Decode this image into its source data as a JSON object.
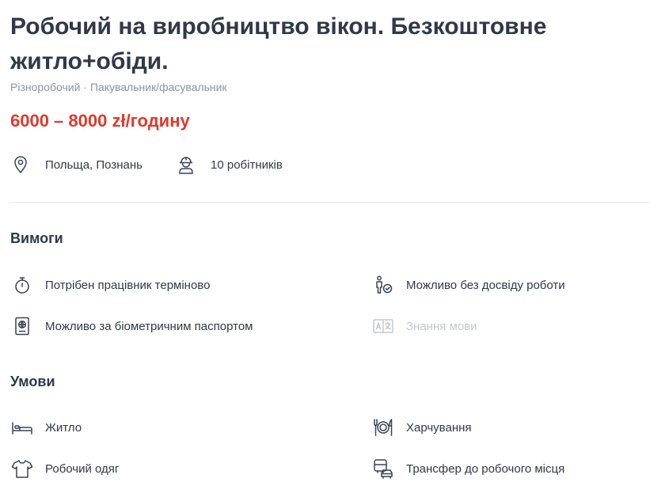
{
  "job": {
    "title": "Робочий на виробництво вікон. Безкоштовне житло+обіди.",
    "categories": [
      "Різноробочий",
      "Пакувальник/фасувальник"
    ],
    "category_separator": "·",
    "salary": "6000 – 8000 zł/годину",
    "location": "Польща, Познань",
    "workers": "10 робітників",
    "location_icon": "map-pin-icon",
    "workers_icon": "worker-helmet-icon"
  },
  "requirements": {
    "title": "Вимоги",
    "items": [
      {
        "label": "Потрібен працівник терміново",
        "icon": "stopwatch-icon",
        "active": true
      },
      {
        "label": "Можливо без досвіду роботи",
        "icon": "person-check-icon",
        "active": true
      },
      {
        "label": "Можливо за біометричним паспортом",
        "icon": "passport-icon",
        "active": true
      },
      {
        "label": "Знання мови",
        "icon": "translate-icon",
        "active": false
      }
    ]
  },
  "conditions": {
    "title": "Умови",
    "items": [
      {
        "label": "Житло",
        "icon": "bed-icon"
      },
      {
        "label": "Харчування",
        "icon": "dining-icon"
      },
      {
        "label": "Робочий одяг",
        "icon": "t-shirt-icon"
      },
      {
        "label": "Трансфер до робочого місця",
        "icon": "bus-icon"
      }
    ]
  },
  "colors": {
    "salary": "#e0392b",
    "text": "#30384a",
    "muted": "#8a93a6",
    "disabled": "#c3c8d2",
    "divider": "#e4e7ec"
  }
}
